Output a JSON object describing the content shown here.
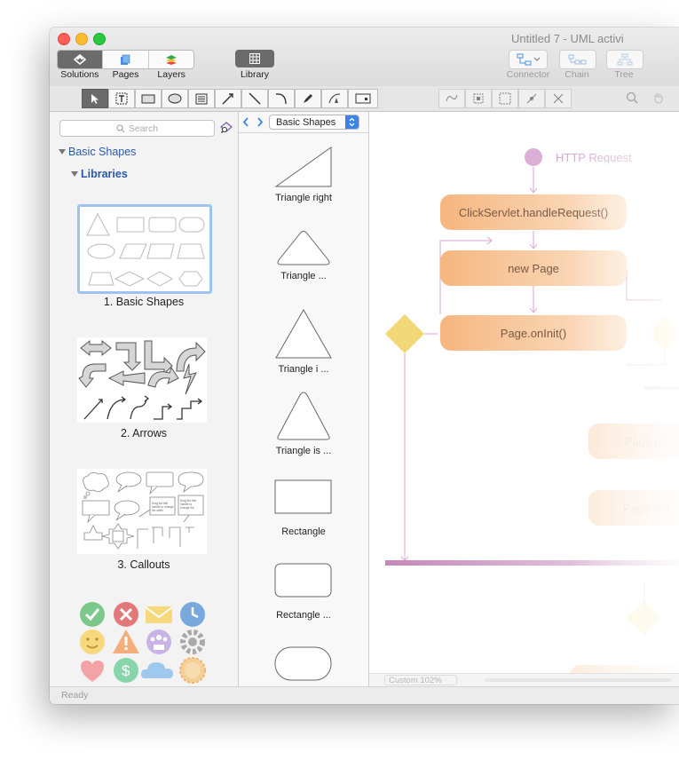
{
  "window": {
    "title": "Untitled 7 - UML activi"
  },
  "toolbar": {
    "segments": [
      "Solutions",
      "Pages",
      "Layers"
    ],
    "library_label": "Library",
    "right_tools": [
      "Connector",
      "Chain",
      "Tree"
    ]
  },
  "sidebar": {
    "search_placeholder": "Search",
    "tree_root": "Basic Shapes",
    "tree_child": "Libraries",
    "libraries": [
      "1. Basic Shapes",
      "2. Arrows",
      "3. Callouts"
    ]
  },
  "shapes_panel": {
    "selected_library": "Basic Shapes",
    "shapes": [
      "Triangle right",
      "Triangle  ...",
      "Triangle i ...",
      "Triangle is ...",
      "Rectangle",
      "Rectangle ..."
    ]
  },
  "canvas": {
    "start_label": "HTTP Request",
    "nodes": [
      "ClickServlet.handleRequest()",
      "new Page",
      "Page.onInit()",
      "Page.on",
      "Page.onI",
      "redirect"
    ],
    "zoom": "Custom 102%"
  },
  "status": {
    "text": "Ready"
  },
  "colors": {
    "accent": "#2a5aa6",
    "activity_fill": "#f6b67f",
    "decision": "#f2d777",
    "flow_line": "#c88fc0"
  }
}
